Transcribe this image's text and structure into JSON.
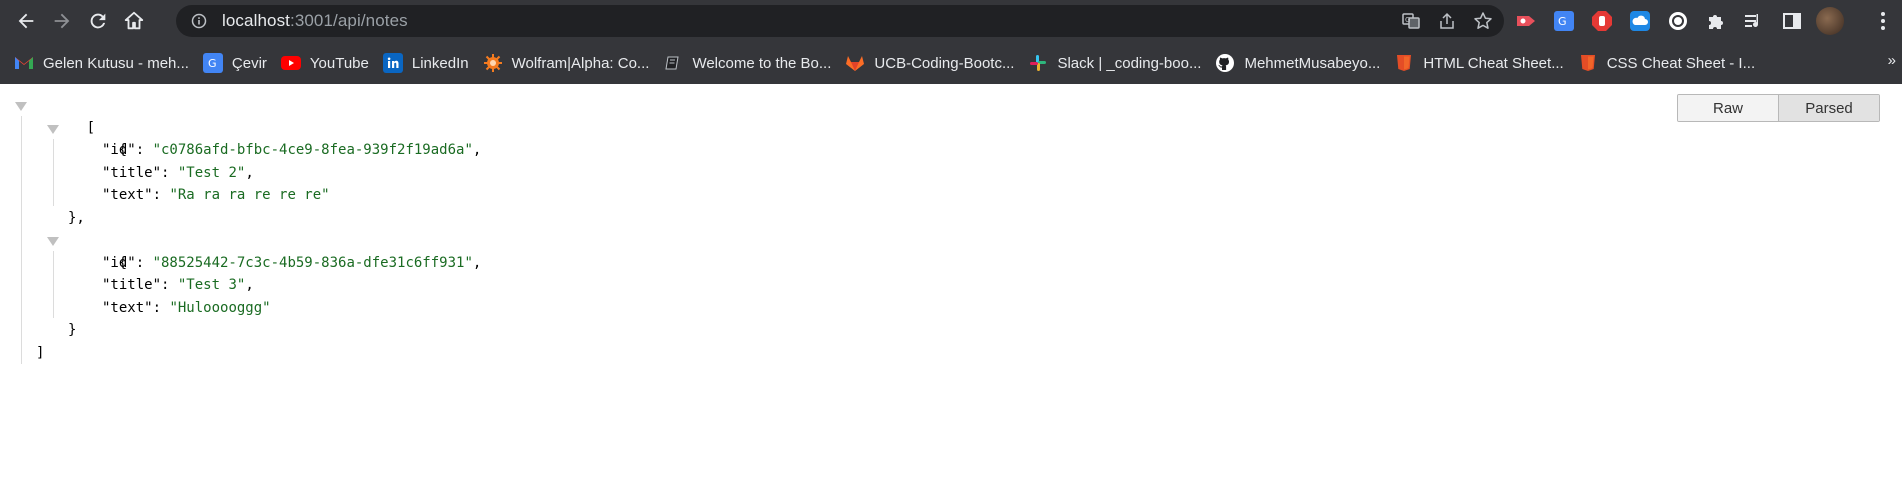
{
  "browser": {
    "url_host": "localhost",
    "url_path": ":3001/api/notes",
    "bookmarks": [
      {
        "label": "Gelen Kutusu - meh...",
        "icon": "gmail-icon"
      },
      {
        "label": "Çevir",
        "icon": "google-translate-icon"
      },
      {
        "label": "YouTube",
        "icon": "youtube-icon"
      },
      {
        "label": "LinkedIn",
        "icon": "linkedin-icon"
      },
      {
        "label": "Wolfram|Alpha: Co...",
        "icon": "wolfram-icon"
      },
      {
        "label": "Welcome to the Bo...",
        "icon": "book-icon"
      },
      {
        "label": "UCB-Coding-Bootc...",
        "icon": "gitlab-icon"
      },
      {
        "label": "Slack | _coding-boo...",
        "icon": "slack-icon"
      },
      {
        "label": "MehmetMusabeyo...",
        "icon": "github-icon"
      },
      {
        "label": "HTML Cheat Sheet...",
        "icon": "html-icon"
      },
      {
        "label": "CSS Cheat Sheet - I...",
        "icon": "css-icon"
      }
    ],
    "more_label": "»"
  },
  "viewer": {
    "raw_label": "Raw",
    "parsed_label": "Parsed",
    "open_array": "[",
    "close_array": "]",
    "notes": [
      {
        "id_key": "\"id\"",
        "id": "\"c0786afd-bfbc-4ce9-8fea-939f2f19ad6a\"",
        "title_key": "\"title\"",
        "title": "\"Test 2\"",
        "text_key": "\"text\"",
        "text": "\"Ra ra ra re re re\"",
        "close": "},"
      },
      {
        "id_key": "\"id\"",
        "id": "\"88525442-7c3c-4b59-836a-dfe31c6ff931\"",
        "title_key": "\"title\"",
        "title": "\"Test 3\"",
        "text_key": "\"text\"",
        "text": "\"Hulooooggg\"",
        "close": "}"
      }
    ]
  },
  "colors": {
    "string": "#1a6b22",
    "chrome_bg": "#35363a",
    "omnibox_bg": "#202124"
  }
}
